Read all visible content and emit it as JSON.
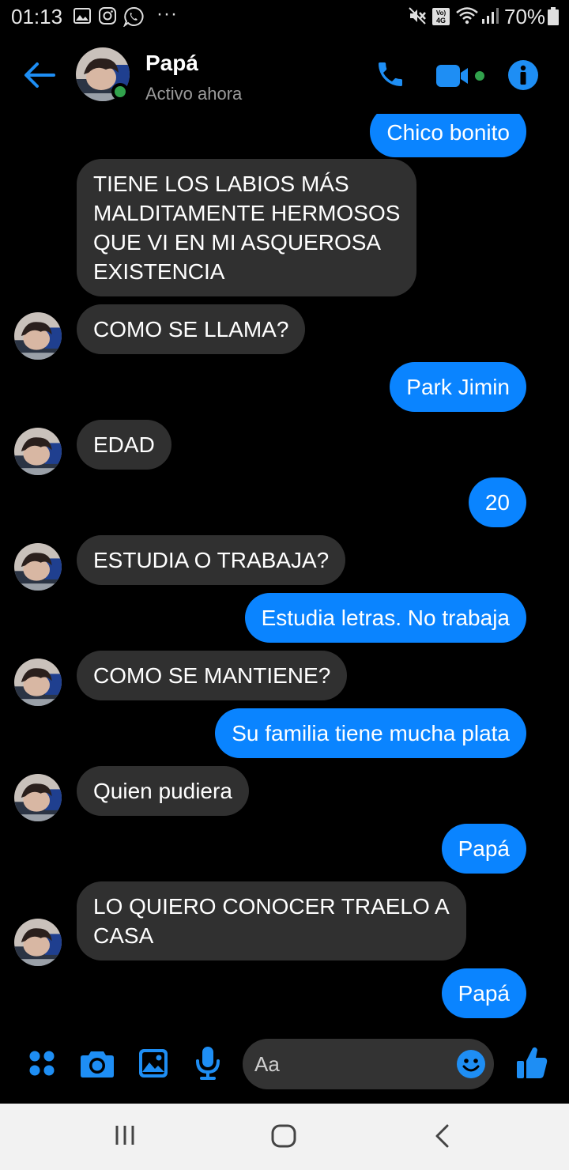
{
  "status_bar": {
    "time": "01:13",
    "battery": "70%",
    "network": "Vo) 4G",
    "notification_icons": [
      "gallery-icon",
      "instagram-icon",
      "whatsapp-icon"
    ],
    "system_icons": [
      "mute-icon",
      "volte-4g-icon",
      "wifi-icon",
      "signal-icon",
      "battery-icon"
    ]
  },
  "header": {
    "contact_name": "Papá",
    "status": "Activo ahora",
    "online": true,
    "actions": [
      "phone-icon",
      "video-call-icon",
      "info-icon"
    ]
  },
  "messages": [
    {
      "dir": "out",
      "text": "Chico bonito",
      "partial": true
    },
    {
      "dir": "in",
      "text": "TIENE LOS LABIOS MÁS\nMALDITAMENTE HERMOSOS\nQUE VI EN MI ASQUEROSA\nEXISTENCIA",
      "avatar": false
    },
    {
      "dir": "in",
      "text": "COMO SE LLAMA?",
      "avatar": true
    },
    {
      "dir": "out",
      "text": "Park Jimin"
    },
    {
      "dir": "in",
      "text": "EDAD",
      "avatar": true
    },
    {
      "dir": "out",
      "text": "20"
    },
    {
      "dir": "in",
      "text": "ESTUDIA O TRABAJA?",
      "avatar": true
    },
    {
      "dir": "out",
      "text": "Estudia letras. No trabaja"
    },
    {
      "dir": "in",
      "text": "COMO SE MANTIENE?",
      "avatar": true
    },
    {
      "dir": "out",
      "text": "Su familia tiene mucha plata"
    },
    {
      "dir": "in",
      "text": "Quien pudiera",
      "avatar": true
    },
    {
      "dir": "out",
      "text": "Papá"
    },
    {
      "dir": "in",
      "text": "LO QUIERO CONOCER TRAELO A\nCASA",
      "avatar": true
    },
    {
      "dir": "out",
      "text": "Papá"
    }
  ],
  "composer": {
    "placeholder": "Aa",
    "buttons": [
      "apps-icon",
      "camera-icon",
      "image-icon",
      "microphone-icon"
    ],
    "emoji": "emoji-icon",
    "send": "thumbs-up-icon"
  },
  "nav_bar": {
    "buttons": [
      "recent-apps-icon",
      "home-icon",
      "back-icon"
    ]
  },
  "colors": {
    "accent": "#0a84ff",
    "incoming_bubble": "#303030",
    "background": "#000000",
    "online": "#31a24c"
  }
}
